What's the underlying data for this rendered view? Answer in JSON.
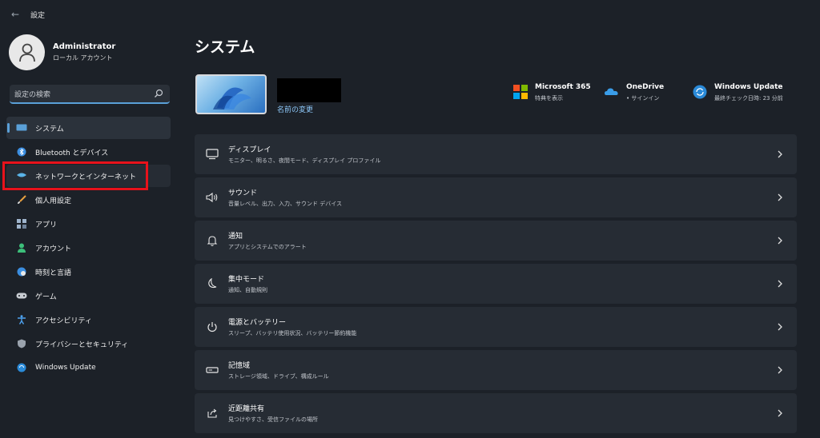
{
  "window": {
    "title": "設定",
    "back": "←"
  },
  "profile": {
    "name": "Administrator",
    "account_type": "ローカル アカウント"
  },
  "search": {
    "placeholder": "設定の検索"
  },
  "nav": [
    {
      "label": "システム",
      "icon": "display-icon",
      "selected": true
    },
    {
      "label": "Bluetooth とデバイス",
      "icon": "bluetooth-icon"
    },
    {
      "label": "ネットワークとインターネット",
      "icon": "wifi-icon"
    },
    {
      "label": "個人用設定",
      "icon": "brush-icon"
    },
    {
      "label": "アプリ",
      "icon": "apps-icon"
    },
    {
      "label": "アカウント",
      "icon": "person-icon"
    },
    {
      "label": "時刻と言語",
      "icon": "globe-clock-icon"
    },
    {
      "label": "ゲーム",
      "icon": "gamepad-icon"
    },
    {
      "label": "アクセシビリティ",
      "icon": "accessibility-icon"
    },
    {
      "label": "プライバシーとセキュリティ",
      "icon": "shield-icon"
    },
    {
      "label": "Windows Update",
      "icon": "windows-update-icon"
    }
  ],
  "main": {
    "title": "システム",
    "rename_link": "名前の変更",
    "quick_links": [
      {
        "title": "Microsoft 365",
        "sub": "特典を表示",
        "icon": "microsoft365-icon"
      },
      {
        "title": "OneDrive",
        "sub": "• サインイン",
        "icon": "onedrive-icon"
      },
      {
        "title": "Windows Update",
        "sub": "最終チェック日時: 23 分前",
        "icon": "windows-update-icon"
      }
    ],
    "cards": [
      {
        "title": "ディスプレイ",
        "sub": "モニター、明るさ、夜間モード、ディスプレイ プロファイル",
        "icon": "monitor-icon"
      },
      {
        "title": "サウンド",
        "sub": "音量レベル、出力、入力、サウンド デバイス",
        "icon": "speaker-icon"
      },
      {
        "title": "通知",
        "sub": "アプリとシステムでのアラート",
        "icon": "bell-icon"
      },
      {
        "title": "集中モード",
        "sub": "通知、自動規則",
        "icon": "moon-icon"
      },
      {
        "title": "電源とバッテリー",
        "sub": "スリープ、バッテリ使用状況、バッテリー節約機能",
        "icon": "power-icon"
      },
      {
        "title": "記憶域",
        "sub": "ストレージ領域、ドライブ、構成ルール",
        "icon": "storage-icon"
      },
      {
        "title": "近距離共有",
        "sub": "見つけやすさ、受信ファイルの場所",
        "icon": "share-icon"
      }
    ]
  },
  "colors": {
    "background": "#1c2128",
    "card": "#262c34",
    "accent": "#5aa0d8",
    "highlight": "#e8121b"
  }
}
